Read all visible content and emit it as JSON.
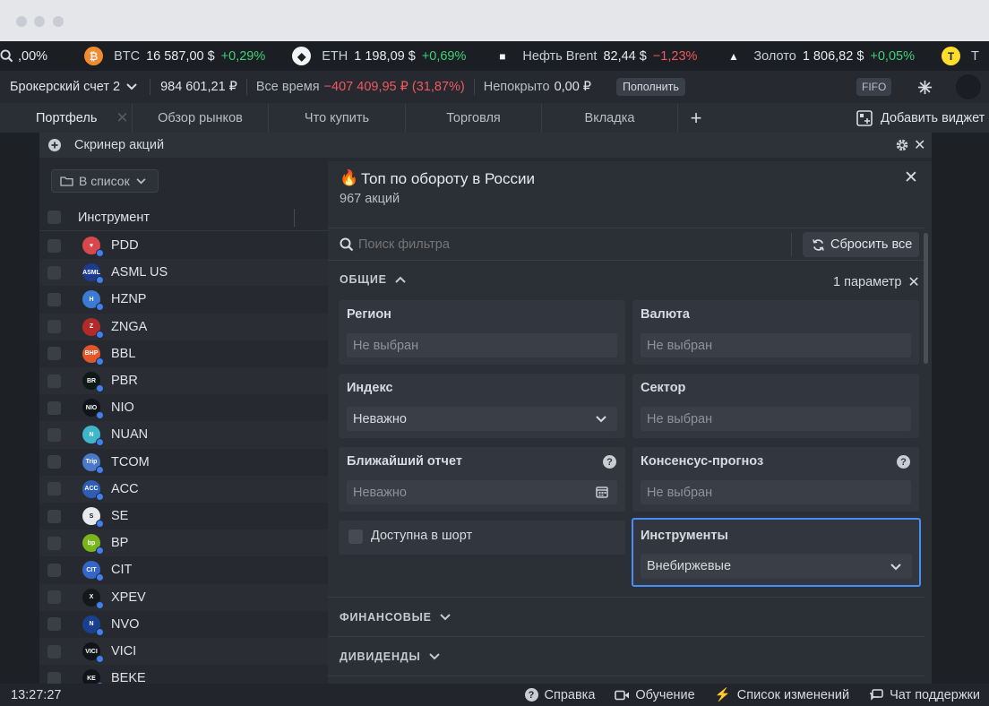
{
  "ticker": {
    "partial_change": ",00%",
    "items": [
      {
        "icon": "bitcoin-icon",
        "icon_char": "₿",
        "icon_color": "#f08c2e",
        "name": "BTC",
        "price": "16 587,00 $",
        "change": "+0,29%",
        "dir": "up"
      },
      {
        "icon": "ethereum-icon",
        "icon_char": "◆",
        "icon_color": "#f2f3f5",
        "name": "ETH",
        "price": "1 198,09 $",
        "change": "+0,69%",
        "dir": "up"
      },
      {
        "icon": "oil-icon",
        "icon_char": "■",
        "icon_color": "#1b1f24",
        "name": "Нефть Brent",
        "price": "82,44 $",
        "change": "−1,23%",
        "dir": "down"
      },
      {
        "icon": "gold-icon",
        "icon_char": "▲",
        "icon_color": "#1b1f24",
        "name": "Золото",
        "price": "1 806,82 $",
        "change": "+0,05%",
        "dir": "up"
      }
    ],
    "tail_icon_char": "T",
    "tail_text": "T"
  },
  "account": {
    "name": "Брокерский счет 2",
    "balance": "984 601,21 ₽",
    "period_label": "Все время",
    "period_result": "−407 409,95 ₽ (31,87%)",
    "uncovered_label": "Непокрыто",
    "uncovered_value": "0,00 ₽",
    "topup_label": "Пополнить",
    "fifo_label": "FIFO"
  },
  "tabs": [
    {
      "label": "Портфель",
      "active": true
    },
    {
      "label": "Обзор рынков"
    },
    {
      "label": "Что купить"
    },
    {
      "label": "Торговля"
    },
    {
      "label": "Вкладка"
    }
  ],
  "add_widget_label": "Добавить виджет",
  "widget": {
    "title": "Скринер акций",
    "inlist_label": "В список",
    "column_instrument": "Инструмент",
    "rows": [
      {
        "ticker": "PDD",
        "color": "#d8474b",
        "mark": "♥"
      },
      {
        "ticker": "ASML US",
        "color": "#1c3b8f",
        "mark": "ASML"
      },
      {
        "ticker": "HZNP",
        "color": "#3b7bd4",
        "mark": "H"
      },
      {
        "ticker": "ZNGA",
        "color": "#b32a2a",
        "mark": "Z"
      },
      {
        "ticker": "BBL",
        "color": "#e2562a",
        "mark": "BHP"
      },
      {
        "ticker": "PBR",
        "color": "#0e1a16",
        "mark": "BR"
      },
      {
        "ticker": "NIO",
        "color": "#111418",
        "mark": "NIO"
      },
      {
        "ticker": "NUAN",
        "color": "#3fb6c9",
        "mark": "N"
      },
      {
        "ticker": "TCOM",
        "color": "#4a79c9",
        "mark": "Trip"
      },
      {
        "ticker": "ACC",
        "color": "#2f5db5",
        "mark": "ACC"
      },
      {
        "ticker": "SE",
        "color": "#e8e9ec",
        "mark": "S"
      },
      {
        "ticker": "BP",
        "color": "#7ab51d",
        "mark": "bp"
      },
      {
        "ticker": "CIT",
        "color": "#3466c9",
        "mark": "CIT"
      },
      {
        "ticker": "XPEV",
        "color": "#15171b",
        "mark": "X"
      },
      {
        "ticker": "NVO",
        "color": "#1b3f8f",
        "mark": "N"
      },
      {
        "ticker": "VICI",
        "color": "#111418",
        "mark": "VICI"
      },
      {
        "ticker": "BEKE",
        "color": "#111418",
        "mark": "KE"
      }
    ]
  },
  "filter": {
    "title": "Топ по обороту в России",
    "subtitle": "967 акций",
    "search_placeholder": "Поиск фильтра",
    "reset_label": "Сбросить все",
    "section_general": "ОБЩИЕ",
    "params_count": "1 параметр",
    "cards": {
      "region": {
        "label": "Регион",
        "value": "Не выбран"
      },
      "currency": {
        "label": "Валюта",
        "value": "Не выбран"
      },
      "index": {
        "label": "Индекс",
        "value": "Неважно"
      },
      "sector": {
        "label": "Сектор",
        "value": "Не выбран"
      },
      "report": {
        "label": "Ближайший отчет",
        "value": "Неважно"
      },
      "consensus": {
        "label": "Консенсус-прогноз",
        "value": "Не выбран"
      },
      "short": {
        "label": "Доступна в шорт"
      },
      "instruments": {
        "label": "Инструменты",
        "value": "Внебиржевые"
      }
    },
    "section_financial": "ФИНАНСОВЫЕ",
    "section_dividends": "ДИВИДЕНДЫ"
  },
  "status": {
    "time": "13:27:27",
    "help": "Справка",
    "learning": "Обучение",
    "changelog": "Список изменений",
    "support": "Чат поддержки"
  },
  "colors": {
    "accent_blue": "#4a8cf7",
    "positive": "#3fd07a",
    "negative": "#f0585d"
  }
}
